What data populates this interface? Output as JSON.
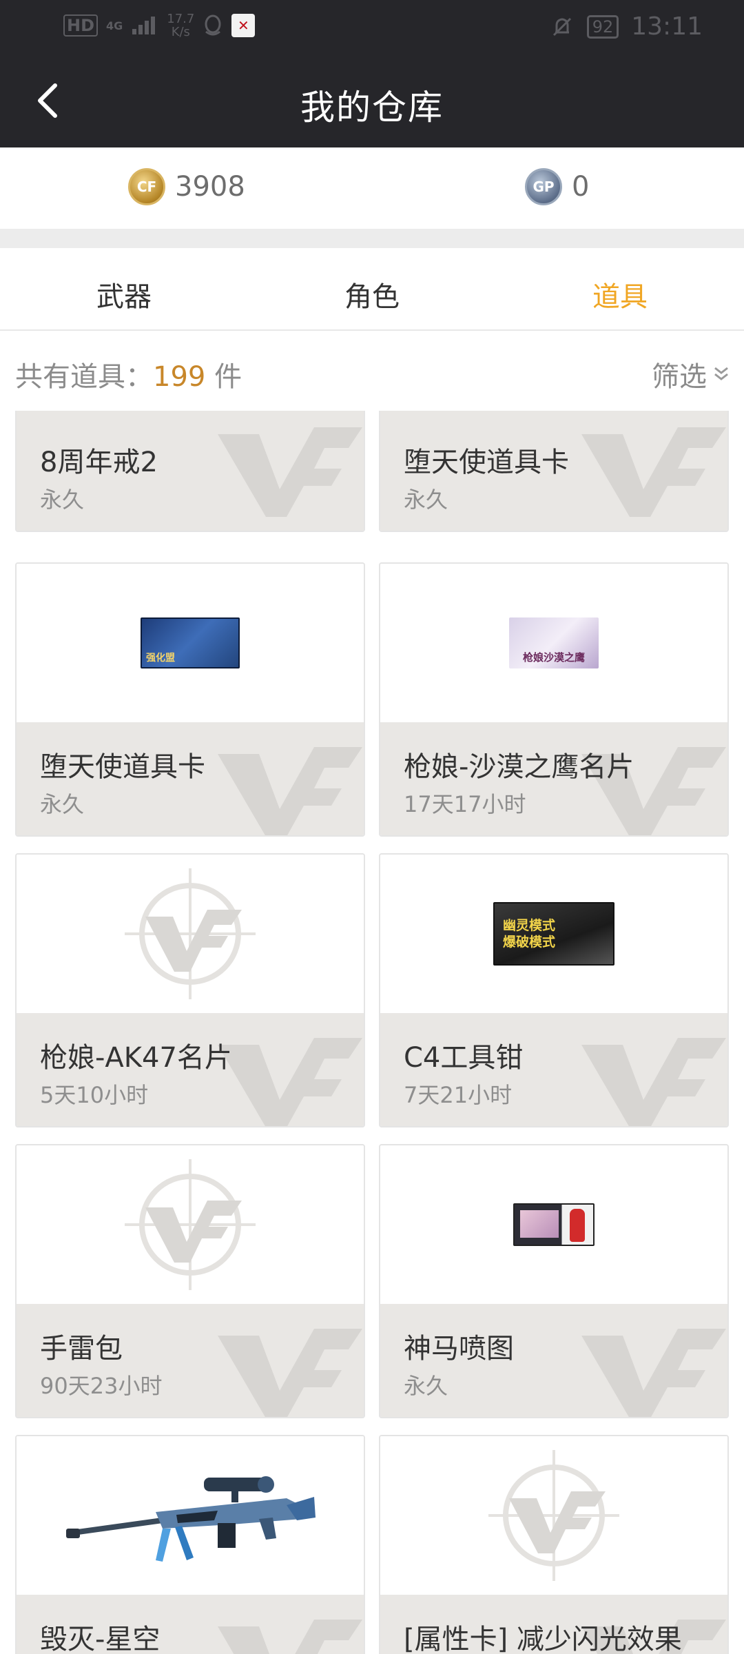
{
  "status_bar": {
    "hd": "HD",
    "network": "4G",
    "speed_value": "17.7",
    "speed_unit": "K/s",
    "battery": "92",
    "time": "13:11"
  },
  "header": {
    "title": "我的仓库",
    "back_icon": "chevron-left-icon"
  },
  "currency": {
    "cf_points": "3908",
    "gp_points": "0",
    "cf_icon_text": "CF",
    "gp_icon_text": "GP"
  },
  "tabs": [
    {
      "label": "武器",
      "active": false
    },
    {
      "label": "角色",
      "active": false
    },
    {
      "label": "道具",
      "active": true
    }
  ],
  "summary": {
    "label": "共有道具：",
    "count": "199",
    "unit": " 件",
    "filter_label": "筛选",
    "filter_icon": "double-chevron-down-icon"
  },
  "colors": {
    "accent": "#f0a623",
    "count": "#c8872a",
    "nav_bg": "#26262a",
    "card_info_bg": "#e9e7e4"
  },
  "items": [
    {
      "name": "8周年戒2",
      "duration": "永久"
    },
    {
      "name": "堕天使道具卡",
      "duration": "永久"
    },
    {
      "name": "堕天使道具卡",
      "duration": "永久",
      "thumb_text": "强化盟"
    },
    {
      "name": "枪娘-沙漠之鹰名片",
      "duration": "17天17小时",
      "thumb_text": "枪娘沙漠之鹰"
    },
    {
      "name": "枪娘-AK47名片",
      "duration": "5天10小时"
    },
    {
      "name": "C4工具钳",
      "duration": "7天21小时",
      "thumb_text_1": "幽灵模式",
      "thumb_text_2": "爆破模式"
    },
    {
      "name": "手雷包",
      "duration": "90天23小时"
    },
    {
      "name": "神马喷图",
      "duration": "永久"
    },
    {
      "name": "毁灭-星空",
      "duration": ""
    },
    {
      "name": "[属性卡] 减少闪光效果",
      "duration": ""
    }
  ]
}
